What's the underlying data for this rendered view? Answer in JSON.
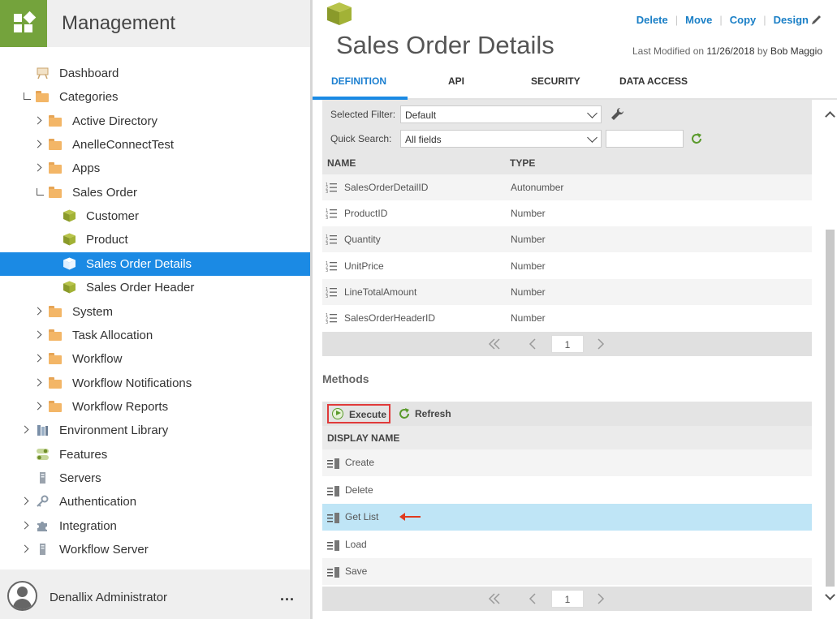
{
  "app": {
    "title": "Management"
  },
  "sidebar": {
    "items": [
      {
        "label": "Dashboard",
        "icon": "easel-icon",
        "level": 0,
        "expander": "none"
      },
      {
        "label": "Categories",
        "icon": "folder-icon",
        "level": 0,
        "expander": "open"
      },
      {
        "label": "Active Directory",
        "icon": "folder-icon",
        "level": 1,
        "expander": "closed"
      },
      {
        "label": "AnelleConnectTest",
        "icon": "folder-icon",
        "level": 1,
        "expander": "closed"
      },
      {
        "label": "Apps",
        "icon": "folder-icon",
        "level": 1,
        "expander": "closed"
      },
      {
        "label": "Sales Order",
        "icon": "folder-icon",
        "level": 1,
        "expander": "open"
      },
      {
        "label": "Customer",
        "icon": "smartobject-icon",
        "level": 2,
        "expander": "none"
      },
      {
        "label": "Product",
        "icon": "smartobject-icon",
        "level": 2,
        "expander": "none"
      },
      {
        "label": "Sales Order Details",
        "icon": "smartobject-icon",
        "level": 2,
        "expander": "none",
        "selected": true
      },
      {
        "label": "Sales Order Header",
        "icon": "smartobject-icon",
        "level": 2,
        "expander": "none"
      },
      {
        "label": "System",
        "icon": "folder-icon",
        "level": 1,
        "expander": "closed"
      },
      {
        "label": "Task Allocation",
        "icon": "folder-icon",
        "level": 1,
        "expander": "closed"
      },
      {
        "label": "Workflow",
        "icon": "folder-icon",
        "level": 1,
        "expander": "closed"
      },
      {
        "label": "Workflow Notifications",
        "icon": "folder-icon",
        "level": 1,
        "expander": "closed"
      },
      {
        "label": "Workflow Reports",
        "icon": "folder-icon",
        "level": 1,
        "expander": "closed"
      },
      {
        "label": "Environment Library",
        "icon": "library-icon",
        "level": 0,
        "expander": "closed"
      },
      {
        "label": "Features",
        "icon": "toggles-icon",
        "level": 0,
        "expander": "none"
      },
      {
        "label": "Servers",
        "icon": "server-icon",
        "level": 0,
        "expander": "none"
      },
      {
        "label": "Authentication",
        "icon": "key-icon",
        "level": 0,
        "expander": "closed"
      },
      {
        "label": "Integration",
        "icon": "puzzle-icon",
        "level": 0,
        "expander": "closed"
      },
      {
        "label": "Workflow Server",
        "icon": "server-icon",
        "level": 0,
        "expander": "closed"
      }
    ],
    "user": {
      "name": "Denallix Administrator",
      "more": "..."
    }
  },
  "header": {
    "title": "Sales Order Details",
    "actions": {
      "delete": "Delete",
      "move": "Move",
      "copy": "Copy",
      "design": "Design"
    },
    "modified_prefix": "Last Modified on",
    "modified_date": "11/26/2018",
    "modified_by_prefix": "by",
    "modified_by": "Bob Maggio"
  },
  "tabs": [
    {
      "label": "DEFINITION",
      "active": true
    },
    {
      "label": "API"
    },
    {
      "label": "SECURITY"
    },
    {
      "label": "DATA ACCESS"
    }
  ],
  "filter": {
    "selected_filter_label": "Selected Filter:",
    "selected_filter_value": "Default",
    "quick_search_label": "Quick Search:",
    "quick_search_value": "All fields",
    "search_text": ""
  },
  "properties": {
    "columns": {
      "name": "NAME",
      "type": "TYPE"
    },
    "rows": [
      {
        "name": "SalesOrderDetailID",
        "type": "Autonumber"
      },
      {
        "name": "ProductID",
        "type": "Number"
      },
      {
        "name": "Quantity",
        "type": "Number"
      },
      {
        "name": "UnitPrice",
        "type": "Number"
      },
      {
        "name": "LineTotalAmount",
        "type": "Number"
      },
      {
        "name": "SalesOrderHeaderID",
        "type": "Number"
      }
    ],
    "page": "1"
  },
  "methods": {
    "title": "Methods",
    "execute_label": "Execute",
    "refresh_label": "Refresh",
    "column": "DISPLAY NAME",
    "rows": [
      {
        "name": "Create"
      },
      {
        "name": "Delete"
      },
      {
        "name": "Get List",
        "selected": true
      },
      {
        "name": "Load"
      },
      {
        "name": "Save"
      }
    ],
    "page": "1"
  },
  "colors": {
    "accent": "#1b8ae4",
    "brand_green": "#74a33c",
    "link": "#1a7fc6",
    "selected_row": "#bfe5f6",
    "highlight_red": "#e03a3a"
  }
}
